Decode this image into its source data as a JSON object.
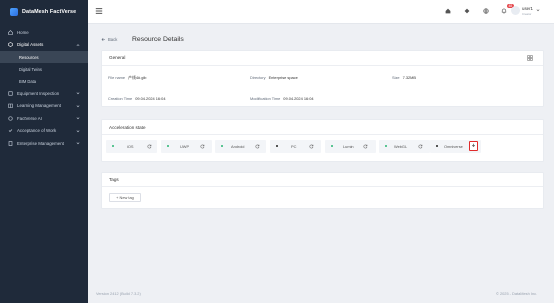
{
  "app": {
    "name": "DataMesh FactVerse"
  },
  "sidebar": {
    "items": [
      {
        "label": "Home"
      },
      {
        "label": "Digital Assets"
      },
      {
        "label": "Resources"
      },
      {
        "label": "Digital Twins"
      },
      {
        "label": "BIM Data"
      },
      {
        "label": "Equipment Inspection"
      },
      {
        "label": "Learning Management"
      },
      {
        "label": "FactVerse AI"
      },
      {
        "label": "Acceptance of Work"
      },
      {
        "label": "Enterprise Management"
      }
    ]
  },
  "topbar": {
    "notification_count": "48",
    "user_name": "user1",
    "user_role": "Creator"
  },
  "page": {
    "back_label": "Back",
    "title": "Resource Details"
  },
  "general": {
    "title": "General",
    "file_name_label": "File name",
    "file_name_value": "产线4#.glb",
    "directory_label": "Directory",
    "directory_value": "Enterprise space",
    "size_label": "Size",
    "size_value": "7.32MB",
    "creation_time_label": "Creation Time",
    "creation_time_value": "09.04.2024 16:04",
    "modification_time_label": "Modification Time",
    "modification_time_value": "09.04.2024 16:04"
  },
  "acceleration": {
    "title": "Acceleration state",
    "platforms": [
      {
        "name": "iOS",
        "status_color": "#2bb673"
      },
      {
        "name": "UWP",
        "status_color": "#2bb673"
      },
      {
        "name": "Android",
        "status_color": "#2bb673"
      },
      {
        "name": "PC",
        "status_color": "#2bb673"
      },
      {
        "name": "Lumin",
        "status_color": "#2bb673"
      },
      {
        "name": "WebGL",
        "status_color": "#2bb673"
      },
      {
        "name": "Omniverse",
        "status_color": "#222222"
      }
    ]
  },
  "tags": {
    "title": "Tags",
    "new_tag_label": "+ New tag"
  },
  "footer": {
    "version": "Version 2412 (Build 7.3.2)",
    "copyright": "© 2025 - DataMesh Inc."
  }
}
